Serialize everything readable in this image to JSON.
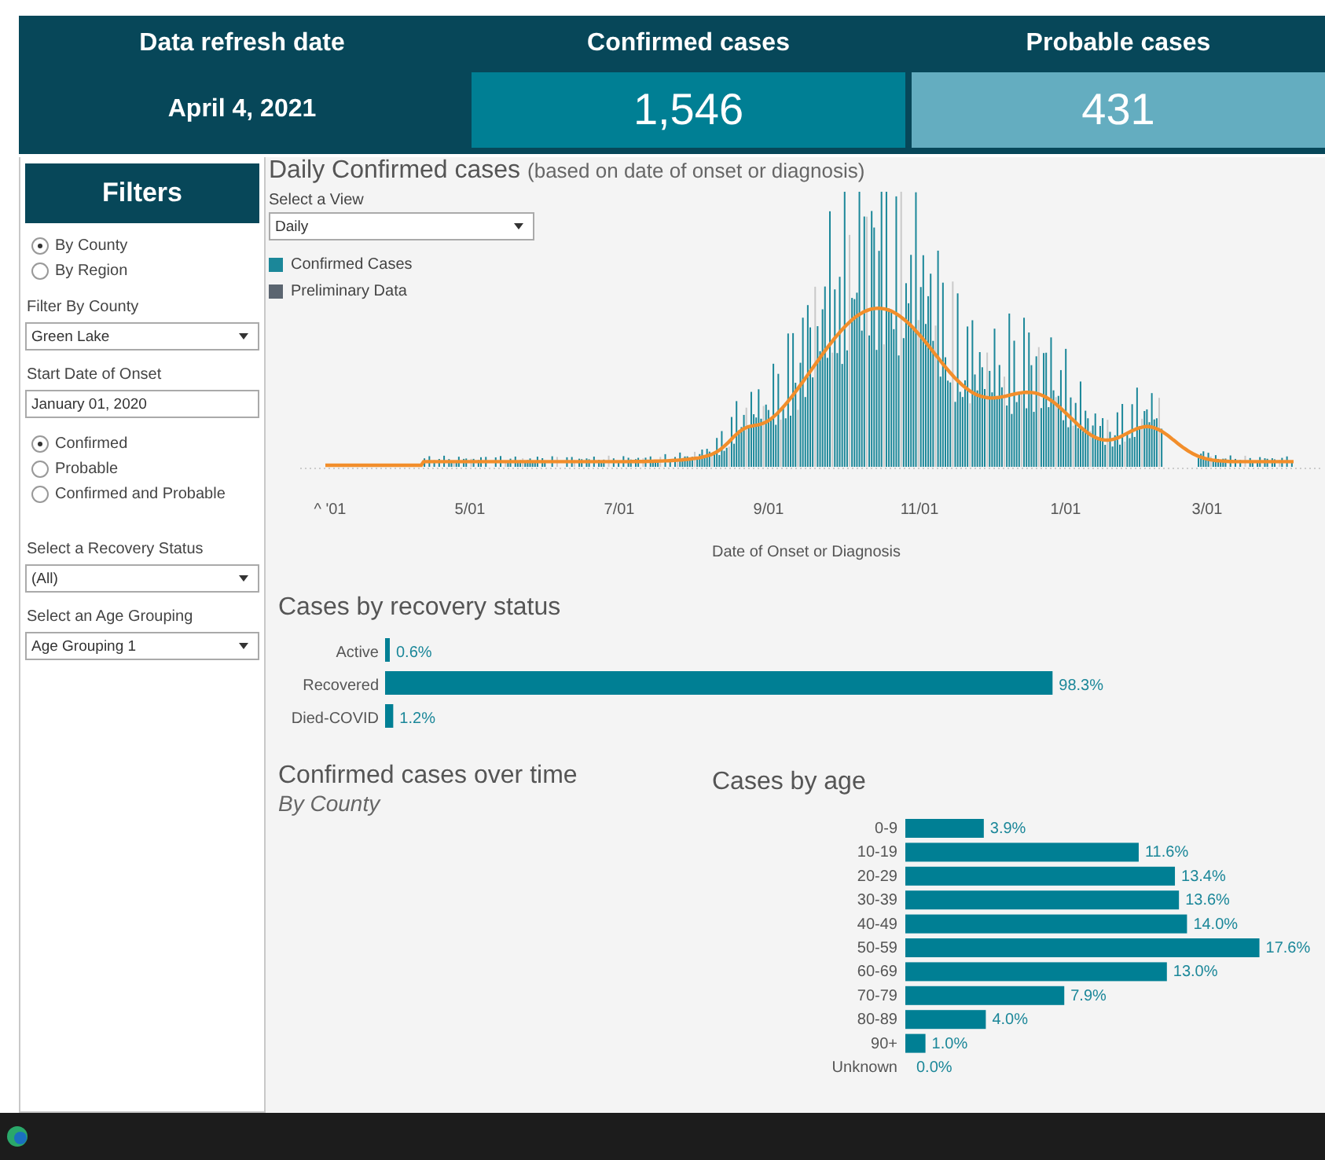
{
  "kpis": [
    {
      "kind": "date",
      "label": "Data refresh date",
      "value": "April 4, 2021"
    },
    {
      "kind": "primary",
      "label": "Confirmed cases",
      "value": "1,546"
    },
    {
      "kind": "secondary",
      "label": "Probable cases",
      "value": "431"
    }
  ],
  "filters": {
    "title": "Filters",
    "group_by": [
      {
        "label": "By County",
        "selected": true
      },
      {
        "label": "By Region",
        "selected": false
      }
    ],
    "county": {
      "label": "Filter By County",
      "value": "Green Lake"
    },
    "start_date": {
      "label": "Start Date of Onset",
      "value": "January 01, 2020"
    },
    "case_type": [
      {
        "label": "Confirmed",
        "selected": true
      },
      {
        "label": "Probable",
        "selected": false
      },
      {
        "label": "Confirmed and Probable",
        "selected": false
      }
    ],
    "recovery": {
      "label": "Select a Recovery Status",
      "value": "(All)"
    },
    "age_grouping": {
      "label": "Select an Age Grouping",
      "value": "Age Grouping 1"
    }
  },
  "daily_chart": {
    "title": "Daily Confirmed cases",
    "subtitle": "(based on date of onset or diagnosis)",
    "view": {
      "label": "Select a View",
      "value": "Daily"
    },
    "legend": [
      {
        "label": "Confirmed Cases",
        "color": "#1b8799"
      },
      {
        "label": "Preliminary Data",
        "color": "#5b6570"
      }
    ],
    "xticks": [
      "^ '01",
      "5/01",
      "7/01",
      "9/01",
      "11/01",
      "1/01",
      "3/01"
    ],
    "xlabel": "Date of Onset or Diagnosis"
  },
  "recovery_chart": {
    "title": "Cases by recovery status",
    "chart_data": {
      "type": "bar",
      "orientation": "horizontal",
      "categories": [
        "Active",
        "Recovered",
        "Died-COVID"
      ],
      "values": [
        0.6,
        98.3,
        1.2
      ],
      "data_labels": true,
      "value_labels": [
        "0.6%",
        "98.3%",
        "1.2%"
      ]
    }
  },
  "time_chart": {
    "title": "Confirmed cases over time",
    "subtitle": "By County"
  },
  "age_chart": {
    "title": "Cases by age",
    "chart_data": {
      "type": "bar",
      "orientation": "horizontal",
      "categories": [
        "0-9",
        "10-19",
        "20-29",
        "30-39",
        "40-49",
        "50-59",
        "60-69",
        "70-79",
        "80-89",
        "90+",
        "Unknown"
      ],
      "values": [
        3.9,
        11.6,
        13.4,
        13.6,
        14.0,
        17.6,
        13.0,
        7.9,
        4.0,
        1.0,
        0.0
      ],
      "data_labels": true,
      "value_labels": [
        "3.9%",
        "11.6%",
        "13.4%",
        "13.6%",
        "14.0%",
        "17.6%",
        "13.0%",
        "7.9%",
        "4.0%",
        "1.0%",
        "0.0%"
      ]
    }
  }
}
